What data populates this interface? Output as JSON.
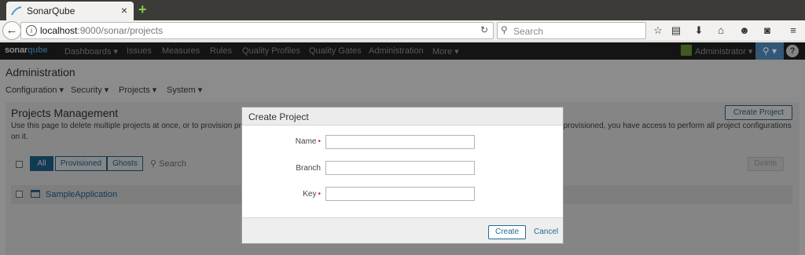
{
  "browser": {
    "tab_title": "SonarQube",
    "tab_close": "×",
    "new_tab": "+",
    "url_host": "localhost",
    "url_rest": ":9000/sonar/projects",
    "search_placeholder": "Search",
    "toolbar_icons": [
      "bookmark-star-icon",
      "reading-list-icon",
      "download-icon",
      "home-icon",
      "chat-icon",
      "pocket-icon",
      "hamburger-menu-icon"
    ]
  },
  "sonar_nav": {
    "logo_text": "sonar",
    "logo_accent": "qube",
    "items": [
      "Dashboards ▾",
      "Issues",
      "Measures",
      "Rules",
      "Quality Profiles",
      "Quality Gates",
      "Administration",
      "More ▾"
    ],
    "user": "Administrator ▾",
    "search_icon": "search-icon",
    "help": "?"
  },
  "admin": {
    "title": "Administration",
    "menu": [
      "Configuration ▾",
      "Security ▾",
      "Projects ▾",
      "System ▾"
    ]
  },
  "projects": {
    "title": "Projects Management",
    "description": "Use this page to delete multiple projects at once, or to provision projects if you would like to configure them before the first analysis. Note that once a project is provisioned, you have access to perform all project configurations on it.",
    "create_label": "Create Project",
    "filters": [
      "All",
      "Provisioned",
      "Ghosts"
    ],
    "active_filter": "All",
    "search_placeholder": "Search",
    "delete_label": "Delete",
    "rows": [
      "SampleApplication"
    ]
  },
  "modal": {
    "title": "Create Project",
    "fields": [
      {
        "label": "Name",
        "required": true,
        "value": ""
      },
      {
        "label": "Branch",
        "required": false,
        "value": ""
      },
      {
        "label": "Key",
        "required": true,
        "value": ""
      }
    ],
    "create_label": "Create",
    "cancel_label": "Cancel"
  },
  "colors": {
    "accent": "#236a97",
    "sonar_nav_bg": "#262626",
    "required": "#d02f3a"
  }
}
